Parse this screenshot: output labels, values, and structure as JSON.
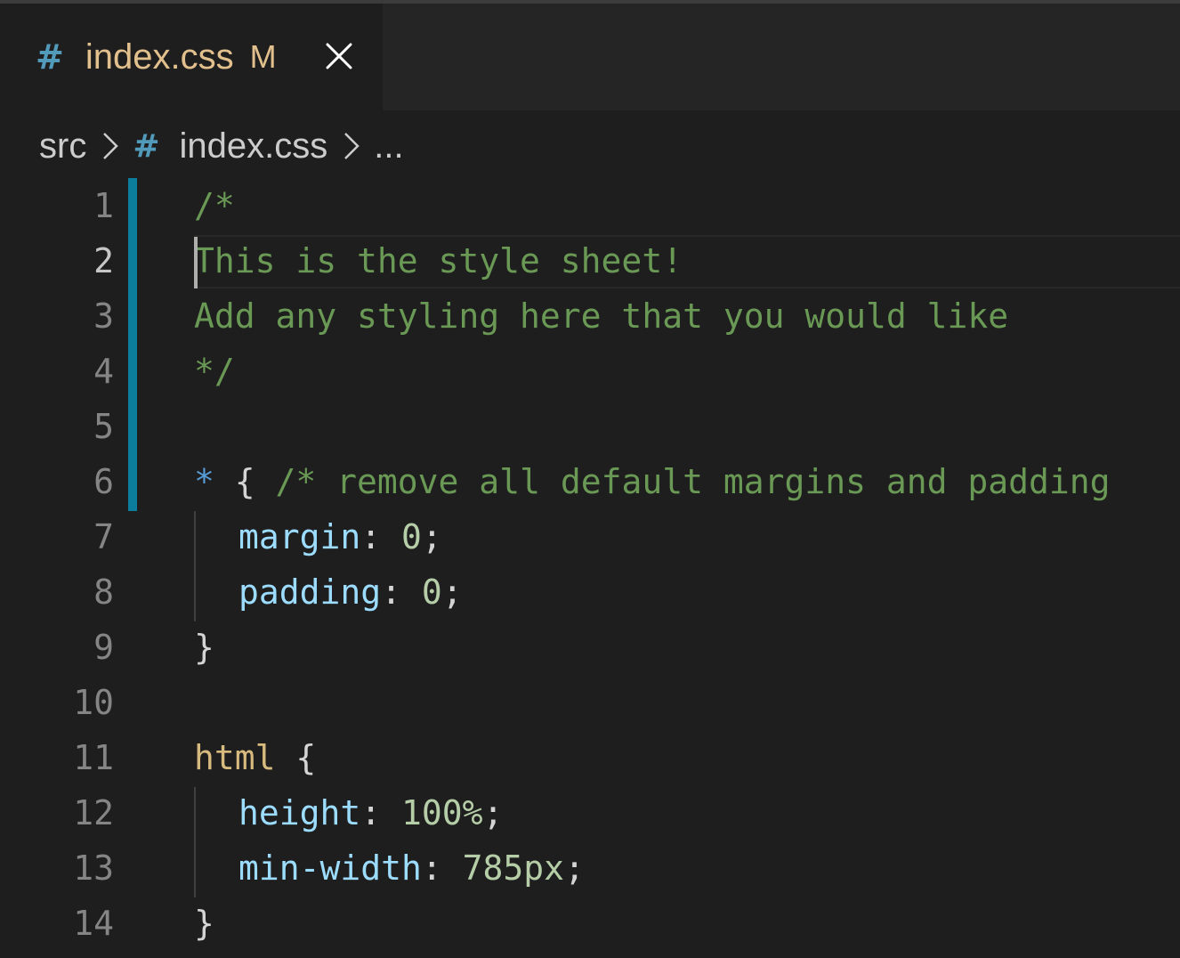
{
  "tab": {
    "icon": "css-hash-icon",
    "icon_glyph": "#",
    "filename": "index.css",
    "status": "M",
    "close_icon": "close-icon"
  },
  "breadcrumb": {
    "folder": "src",
    "file_icon_glyph": "#",
    "file": "index.css",
    "more": "..."
  },
  "colors": {
    "background": "#1e1e1e",
    "comment": "#6a9955",
    "property": "#9cdcfe",
    "number": "#b5cea8",
    "selector": "#d7ba7d",
    "modified": "#e2c08d",
    "git_bar": "#0c7d9d"
  },
  "editor": {
    "active_line": 2,
    "lines": [
      {
        "n": "1",
        "t1": "/*"
      },
      {
        "n": "2",
        "t1": "This is the style sheet!"
      },
      {
        "n": "3",
        "t1": "Add any styling here that you would like"
      },
      {
        "n": "4",
        "t1": "*/"
      },
      {
        "n": "5"
      },
      {
        "n": "6",
        "t1": "*",
        "t2": " { ",
        "t3": "/* remove all default margins and padding"
      },
      {
        "n": "7",
        "t1": "margin",
        "t2": ": ",
        "t3": "0",
        "t4": ";"
      },
      {
        "n": "8",
        "t1": "padding",
        "t2": ": ",
        "t3": "0",
        "t4": ";"
      },
      {
        "n": "9",
        "t1": "}"
      },
      {
        "n": "10"
      },
      {
        "n": "11",
        "t1": "html",
        "t2": " {"
      },
      {
        "n": "12",
        "t1": "height",
        "t2": ": ",
        "t3": "100%",
        "t4": ";"
      },
      {
        "n": "13",
        "t1": "min-width",
        "t2": ": ",
        "t3": "785px",
        "t4": ";"
      },
      {
        "n": "14",
        "t1": "}"
      }
    ]
  }
}
